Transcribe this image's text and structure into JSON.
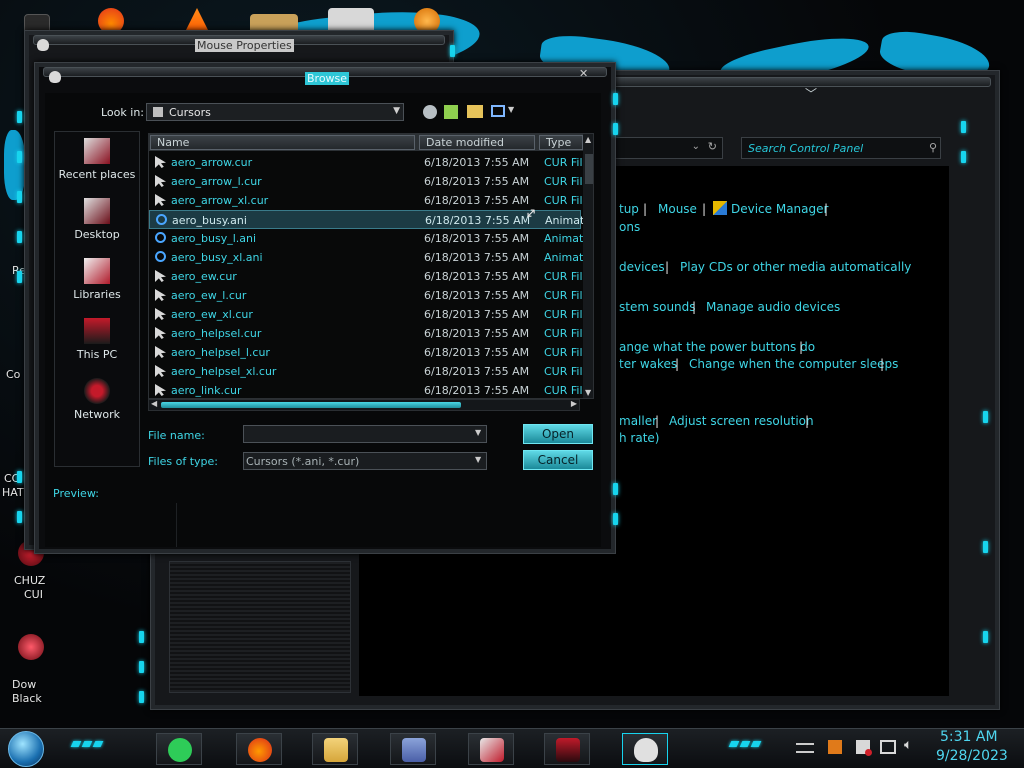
{
  "desktop": {
    "labels": [
      "Re",
      "Co",
      "CC",
      "HAT",
      "CHUZ",
      "CUI",
      "Dow",
      "Black"
    ]
  },
  "control_panel": {
    "search_placeholder": "Search Control Panel",
    "links": [
      "tup",
      "Mouse",
      "Device Manager",
      "ons",
      "devices",
      "Play CDs or other media automatically",
      "stem sounds",
      "Manage audio devices",
      "ange what the power buttons do",
      "ter wakes",
      "Change when the computer sleeps",
      "maller",
      "Adjust screen resolution",
      "h rate)"
    ]
  },
  "mouse_properties": {
    "title": "Mouse Properties"
  },
  "browse": {
    "title": "Browse",
    "look_in_label": "Look in:",
    "look_in_value": "Cursors",
    "places": [
      "Recent places",
      "Desktop",
      "Libraries",
      "This PC",
      "Network"
    ],
    "columns": [
      "Name",
      "Date modified",
      "Type"
    ],
    "files": [
      {
        "name": "aero_arrow.cur",
        "date": "6/18/2013 7:55 AM",
        "type": "CUR File",
        "kind": "cur"
      },
      {
        "name": "aero_arrow_l.cur",
        "date": "6/18/2013 7:55 AM",
        "type": "CUR File",
        "kind": "cur"
      },
      {
        "name": "aero_arrow_xl.cur",
        "date": "6/18/2013 7:55 AM",
        "type": "CUR File",
        "kind": "cur"
      },
      {
        "name": "aero_busy.ani",
        "date": "6/18/2013 7:55 AM",
        "type": "Animated",
        "kind": "ani",
        "selected": true
      },
      {
        "name": "aero_busy_l.ani",
        "date": "6/18/2013 7:55 AM",
        "type": "Animated",
        "kind": "ani"
      },
      {
        "name": "aero_busy_xl.ani",
        "date": "6/18/2013 7:55 AM",
        "type": "Animated",
        "kind": "ani"
      },
      {
        "name": "aero_ew.cur",
        "date": "6/18/2013 7:55 AM",
        "type": "CUR File",
        "kind": "cur"
      },
      {
        "name": "aero_ew_l.cur",
        "date": "6/18/2013 7:55 AM",
        "type": "CUR File",
        "kind": "cur"
      },
      {
        "name": "aero_ew_xl.cur",
        "date": "6/18/2013 7:55 AM",
        "type": "CUR File",
        "kind": "cur"
      },
      {
        "name": "aero_helpsel.cur",
        "date": "6/18/2013 7:55 AM",
        "type": "CUR File",
        "kind": "cur"
      },
      {
        "name": "aero_helpsel_l.cur",
        "date": "6/18/2013 7:55 AM",
        "type": "CUR File",
        "kind": "cur"
      },
      {
        "name": "aero_helpsel_xl.cur",
        "date": "6/18/2013 7:55 AM",
        "type": "CUR File",
        "kind": "cur"
      },
      {
        "name": "aero_link.cur",
        "date": "6/18/2013 7:55 AM",
        "type": "CUR File",
        "kind": "cur"
      }
    ],
    "file_name_label": "File name:",
    "file_name_value": "",
    "files_of_type_label": "Files of type:",
    "files_of_type_value": "Cursors (*.ani, *.cur)",
    "open_label": "Open",
    "cancel_label": "Cancel",
    "preview_label": "Preview:"
  },
  "taskbar": {
    "apps": [
      "spotify-icon",
      "firefox-icon",
      "file-explorer-icon",
      "control-panel-icon",
      "photo-viewer-icon",
      "game-icon",
      "mouse-settings-icon"
    ],
    "time": "5:31 AM",
    "date": "9/28/2023"
  },
  "colors": {
    "accent": "#17d4ee",
    "link": "#3fd6e6",
    "selection": "#1c3b44"
  }
}
